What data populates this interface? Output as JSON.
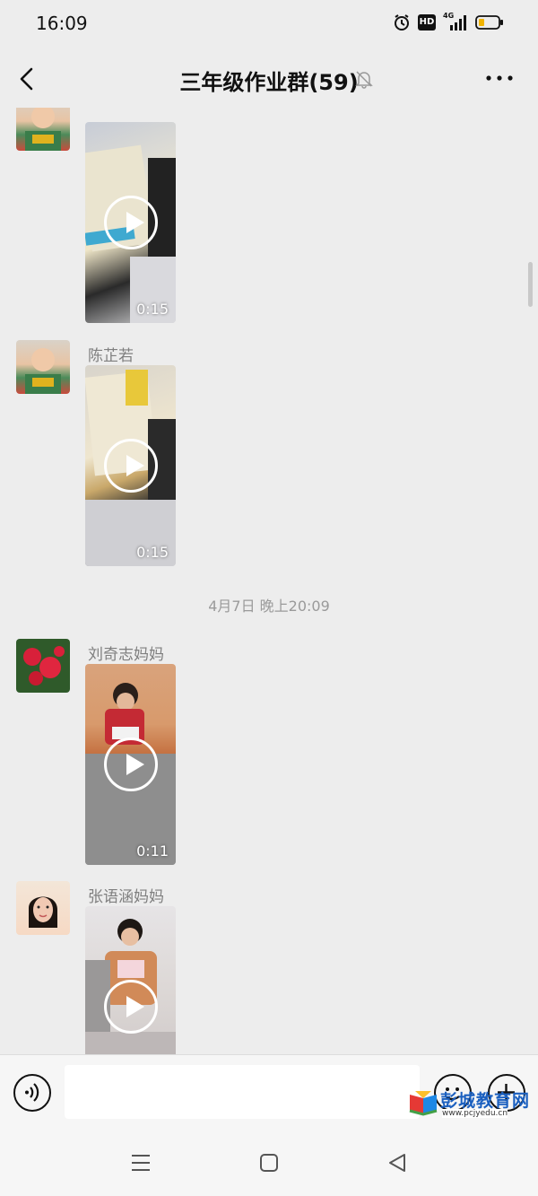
{
  "status_bar": {
    "time": "16:09",
    "hd": "HD",
    "network": "4G"
  },
  "header": {
    "title": "三年级作业群(59)"
  },
  "messages": [
    {
      "sender": "陈芷若",
      "duration": "0:15"
    },
    {
      "sender": "陈芷若",
      "duration": "0:15"
    },
    {
      "sender": "刘奇志妈妈",
      "duration": "0:11"
    },
    {
      "sender": "张语涵妈妈",
      "duration": ""
    }
  ],
  "timestamp": "4月7日 晚上20:09",
  "watermark": {
    "title": "彭城教育网",
    "url": "www.pcjyedu.cn"
  },
  "icons": [
    "alarm-icon",
    "hd-icon",
    "signal-icon",
    "battery-icon",
    "back-icon",
    "mute-bell-icon",
    "more-icon",
    "voice-icon",
    "emoji-icon",
    "plus-icon",
    "menu-icon",
    "home-icon",
    "back-triangle-icon"
  ],
  "colors": {
    "background": "#ededed",
    "sender_text": "#7f7f7f",
    "timestamp_text": "#9a9a9a",
    "watermark_blue": "#1a5fbf"
  }
}
